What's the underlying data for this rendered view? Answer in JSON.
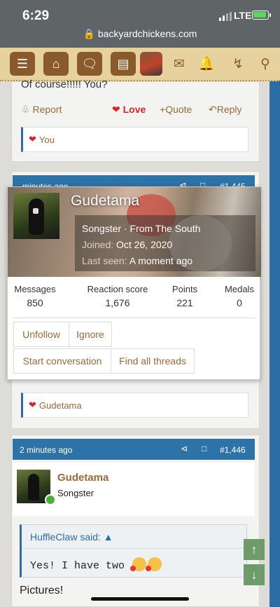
{
  "status": {
    "time": "6:29",
    "network": "LTE",
    "url": "backyardchickens.com"
  },
  "nav": {
    "icons": [
      "menu-icon",
      "home-icon",
      "chat-icon",
      "document-icon",
      "avatar",
      "mail-icon",
      "bell-icon",
      "lightning-icon",
      "search-icon"
    ]
  },
  "top_post": {
    "text_cut": "Of course!!!!! You?",
    "actions": {
      "report": "Report",
      "love": "Love",
      "quote": "Quote",
      "reply": "Reply"
    },
    "reaction_user": "You"
  },
  "middle_post": {
    "time_cut": "minutes ago",
    "post_number_cut": "#1,445",
    "reaction_user": "Gudetama"
  },
  "popup": {
    "username": "Gudetama",
    "role": "Songster · From The South",
    "joined_label": "Joined:",
    "joined_value": "Oct 26, 2020",
    "last_seen_label": "Last seen:",
    "last_seen_value": "A moment ago",
    "stats": [
      {
        "label": "Messages",
        "value": "850"
      },
      {
        "label": "Reaction score",
        "value": "1,676"
      },
      {
        "label": "Points",
        "value": "221"
      },
      {
        "label": "Medals",
        "value": "0"
      }
    ],
    "buttons": {
      "unfollow": "Unfollow",
      "ignore": "Ignore",
      "start_conversation": "Start conversation",
      "find_threads": "Find all threads"
    }
  },
  "bottom_post": {
    "time": "2 minutes ago",
    "post_number": "#1,446",
    "username": "Gudetama",
    "role": "Songster",
    "quote_author": "HuffleClaw said:",
    "quote_text": "Yes! I have two",
    "body": "Pictures!"
  },
  "colors": {
    "nav_bg": "#e7d29f",
    "nav_btn": "#8a5a2b",
    "post_bar": "#2e73a8",
    "link": "#9a6a38",
    "love": "#d22222"
  }
}
